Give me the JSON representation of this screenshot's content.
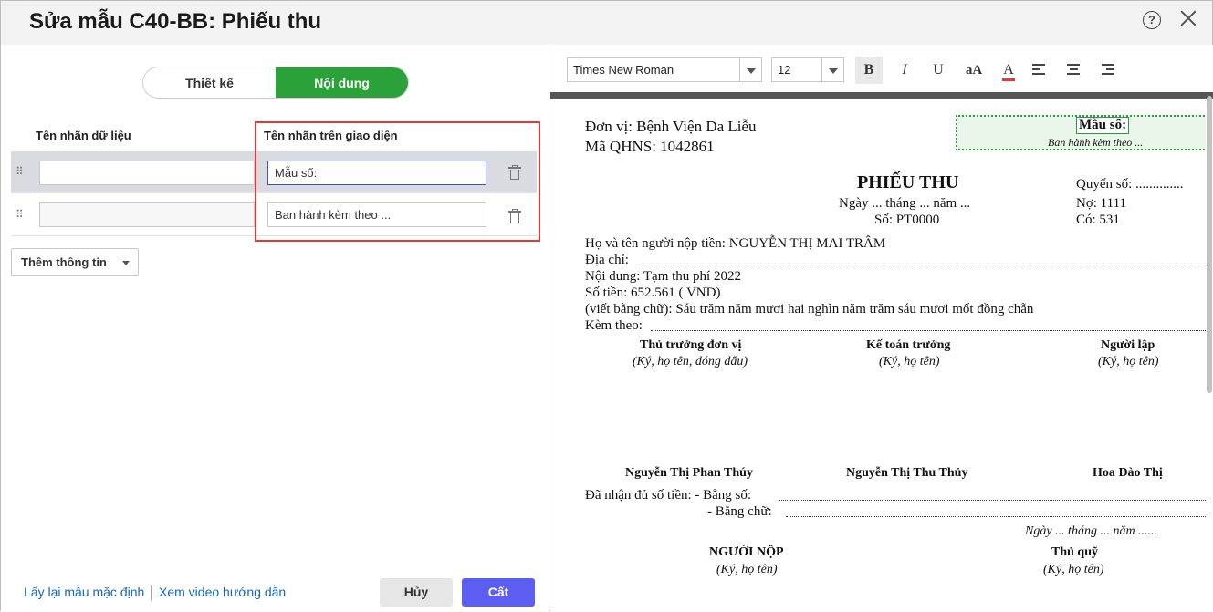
{
  "header": {
    "title": "Sửa mẫu C40-BB: Phiếu thu"
  },
  "tabs": [
    {
      "label": "Thiết kế",
      "active": false
    },
    {
      "label": "Nội dung",
      "active": true
    }
  ],
  "columns": {
    "data_label": "Tên nhãn dữ liệu",
    "ui_label": "Tên nhãn trên giao diện"
  },
  "rows": [
    {
      "data_value": "",
      "ui_value": "Mẫu số:",
      "selected": true
    },
    {
      "data_value": "",
      "ui_value": "Ban hành kèm theo ..."
    }
  ],
  "add_button": {
    "label": "Thêm thông tin"
  },
  "footer": {
    "reset_link": "Lấy lại mẫu mặc định",
    "video_link": "Xem video hướng dẫn",
    "cancel": "Hủy",
    "save": "Cất"
  },
  "toolbar": {
    "font": "Times New Roman",
    "size": "12",
    "bold": "B",
    "italic": "I",
    "underline": "U",
    "case": "aA",
    "color_letter": "A",
    "color": "#e53935",
    "icons": [
      "bold-icon",
      "italic-icon",
      "underline-icon",
      "font-case-icon",
      "font-color-icon",
      "align-left-icon",
      "align-center-icon",
      "align-right-icon"
    ]
  },
  "doc": {
    "unit": "Đơn vị: Bệnh Viện Da Liễu",
    "qhns": "Mã QHNS: 1042861",
    "mau_so": "Mẫu số:",
    "ban_hanh": "Ban hành kèm theo ...",
    "title": "PHIẾU THU",
    "date": "Ngày ... tháng ... năm ...",
    "so": "Số:  PT0000",
    "quyen_so": "Quyển số: ..............",
    "no": "Nợ: 1111",
    "co": "Có: 531",
    "payer": "Họ và tên người nộp tiền: NGUYỄN THỊ MAI TRÂM",
    "address": "Địa chỉ:",
    "content": "Nội dung: Tạm thu phí 2022",
    "amount": "Số tiền: 652.561   ( VND)",
    "words": "(viết bằng chữ): Sáu trăm năm mươi hai nghìn năm trăm sáu mươi mốt đồng chẵn",
    "attach": "Kèm theo:",
    "sig1_title": "Thủ trưởng đơn vị",
    "sig1_note": "(Ký, họ tên, đóng dấu)",
    "sig2_title": "Kế toán trưởng",
    "sig2_note": "(Ký, họ tên)",
    "sig3_title": "Người lập",
    "sig3_note": "(Ký, họ tên)",
    "sig1_name": "Nguyễn Thị Phan Thúy",
    "sig2_name": "Nguyễn Thị Thu Thủy",
    "sig3_name": "Hoa Đào Thị",
    "received": "Đã nhận đủ số tiền: - Bằng số:",
    "by_words": "- Bằng chữ:",
    "date2": "Ngày ... tháng ... năm ......",
    "payer_title": "NGƯỜI NỘP",
    "payer_note": "(Ký, họ tên)",
    "cashier_title": "Thủ quỹ",
    "cashier_note": "(Ký, họ tên)"
  }
}
